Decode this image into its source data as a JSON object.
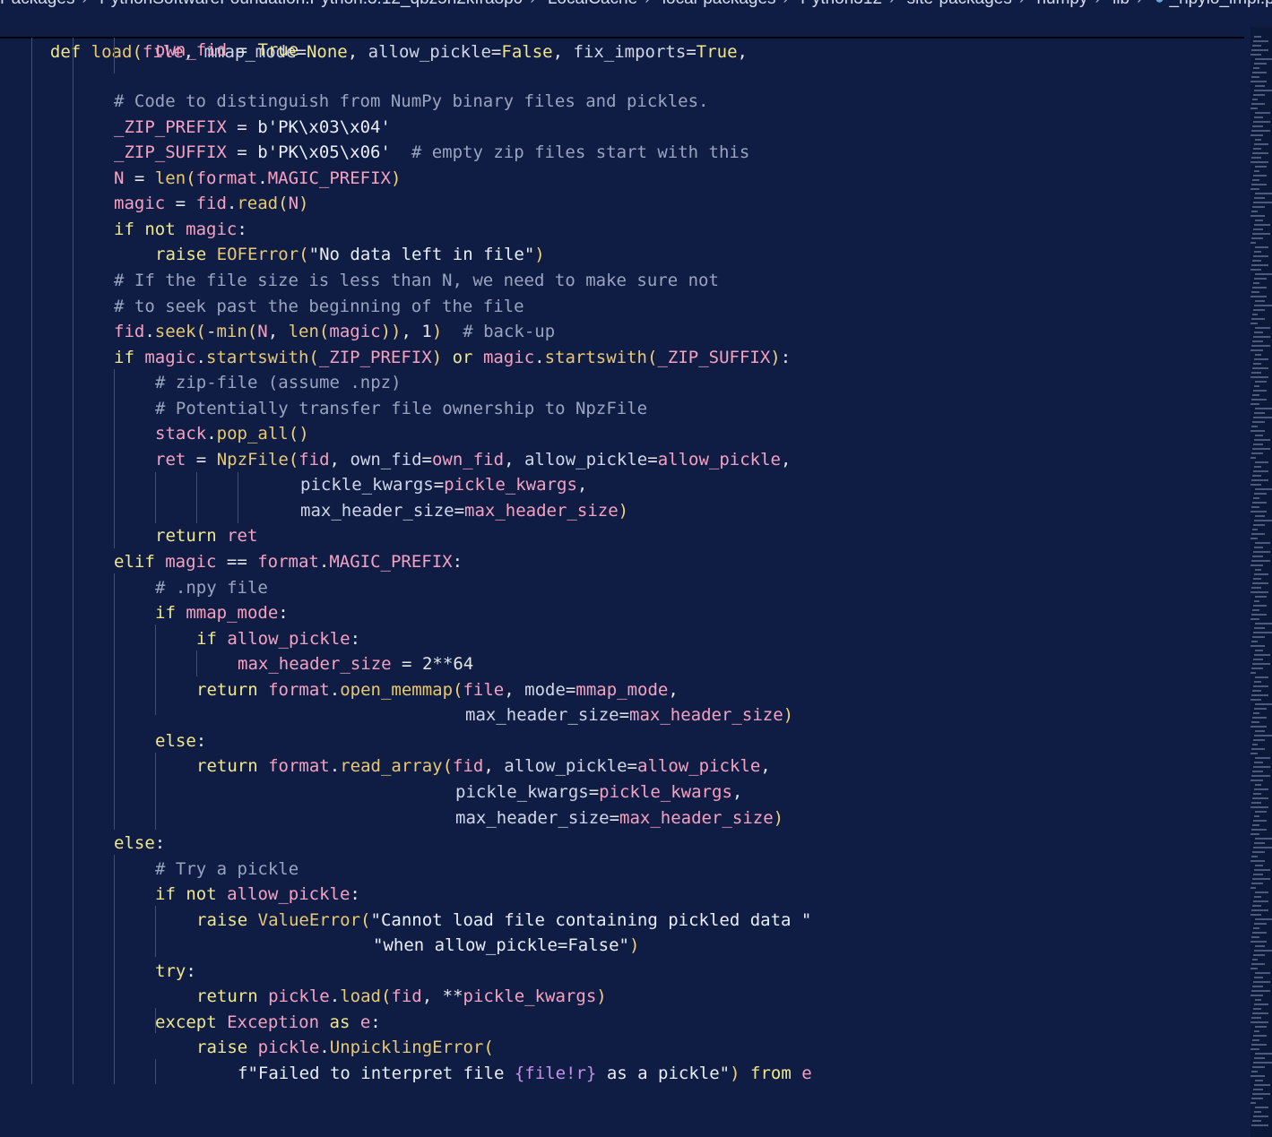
{
  "breadcrumb": [
    "Packages",
    "PythonSoftwareFoundation.Python.3.12_qbz5n2kfra8p0",
    "LocalCache",
    "local-packages",
    "Python312",
    "site-packages",
    "numpy",
    "lib",
    "_npyio_impl.py"
  ],
  "sticky_header": "def load(file, mmap_mode=None, allow_pickle=False, fix_imports=True,",
  "lines": [
    "own_fid = True",
    "",
    "# Code to distinguish from NumPy binary files and pickles.",
    "_ZIP_PREFIX = b'PK\\x03\\x04'",
    "_ZIP_SUFFIX = b'PK\\x05\\x06'  # empty zip files start with this",
    "N = len(format.MAGIC_PREFIX)",
    "magic = fid.read(N)",
    "if not magic:",
    "raise EOFError(\"No data left in file\")",
    "# If the file size is less than N, we need to make sure not",
    "# to seek past the beginning of the file",
    "fid.seek(-min(N, len(magic)), 1)  # back-up",
    "if magic.startswith(_ZIP_PREFIX) or magic.startswith(_ZIP_SUFFIX):",
    "# zip-file (assume .npz)",
    "# Potentially transfer file ownership to NpzFile",
    "stack.pop_all()",
    "ret = NpzFile(fid, own_fid=own_fid, allow_pickle=allow_pickle,",
    "pickle_kwargs=pickle_kwargs,",
    "max_header_size=max_header_size)",
    "return ret",
    "elif magic == format.MAGIC_PREFIX:",
    "# .npy file",
    "if mmap_mode:",
    "if allow_pickle:",
    "max_header_size = 2**64",
    "return format.open_memmap(file, mode=mmap_mode,",
    "max_header_size=max_header_size)",
    "else:",
    "return format.read_array(fid, allow_pickle=allow_pickle,",
    "pickle_kwargs=pickle_kwargs,",
    "max_header_size=max_header_size)",
    "else:",
    "# Try a pickle",
    "if not allow_pickle:",
    "raise ValueError(\"Cannot load file containing pickled data \"",
    "\"when allow_pickle=False\")",
    "try:",
    "return pickle.load(fid, **pickle_kwargs)",
    "except Exception as e:",
    "raise pickle.UnpicklingError(",
    "f\"Failed to interpret file {file!r} as a pickle\") from e"
  ],
  "theme": {
    "background": "#0f1d45",
    "keyword": "#f0e68c",
    "variable": "#f5a1c0",
    "comment": "#9aa4bf"
  }
}
